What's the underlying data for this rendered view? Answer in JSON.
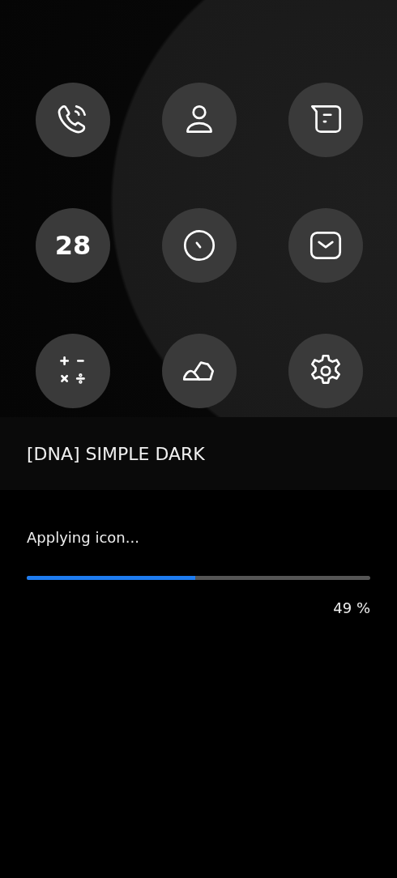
{
  "theme_preview": {
    "icons": [
      {
        "kind": "phone"
      },
      {
        "kind": "contact"
      },
      {
        "kind": "message"
      },
      {
        "kind": "calendar",
        "text": "28"
      },
      {
        "kind": "clock"
      },
      {
        "kind": "mail"
      },
      {
        "kind": "calculator"
      },
      {
        "kind": "gallery"
      },
      {
        "kind": "settings"
      }
    ]
  },
  "theme_name": "[DNA] SIMPLE DARK",
  "progress": {
    "label": "Applying icon...",
    "level": 0.49,
    "reading": "49 %"
  }
}
